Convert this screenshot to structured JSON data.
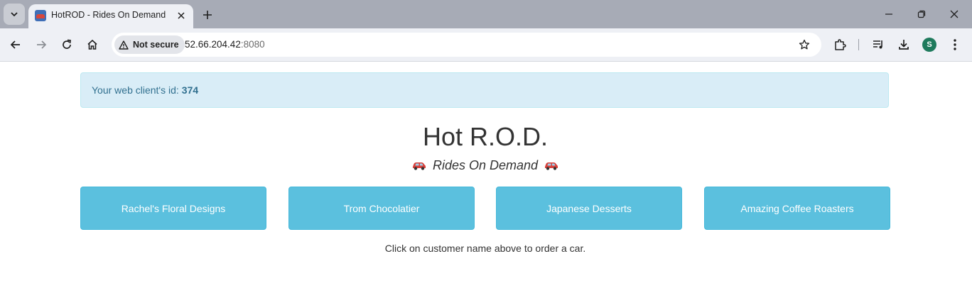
{
  "browser": {
    "tab": {
      "title": "HotROD - Rides On Demand"
    },
    "address_bar": {
      "security_label": "Not secure",
      "host": "52.66.204.42",
      "port": ":8080"
    },
    "profile_initial": "S"
  },
  "page": {
    "alert": {
      "prefix": "Your web client's id:",
      "client_id": "374"
    },
    "title": "Hot R.O.D.",
    "subtitle": "Rides On Demand",
    "customers": [
      {
        "label": "Rachel's Floral Designs"
      },
      {
        "label": "Trom Chocolatier"
      },
      {
        "label": "Japanese Desserts"
      },
      {
        "label": "Amazing Coffee Roasters"
      }
    ],
    "hint": "Click on customer name above to order a car."
  },
  "colors": {
    "alert_bg": "#d9edf7",
    "alert_text": "#31708f",
    "button_info": "#5bc0de",
    "title_text": "#333333"
  }
}
